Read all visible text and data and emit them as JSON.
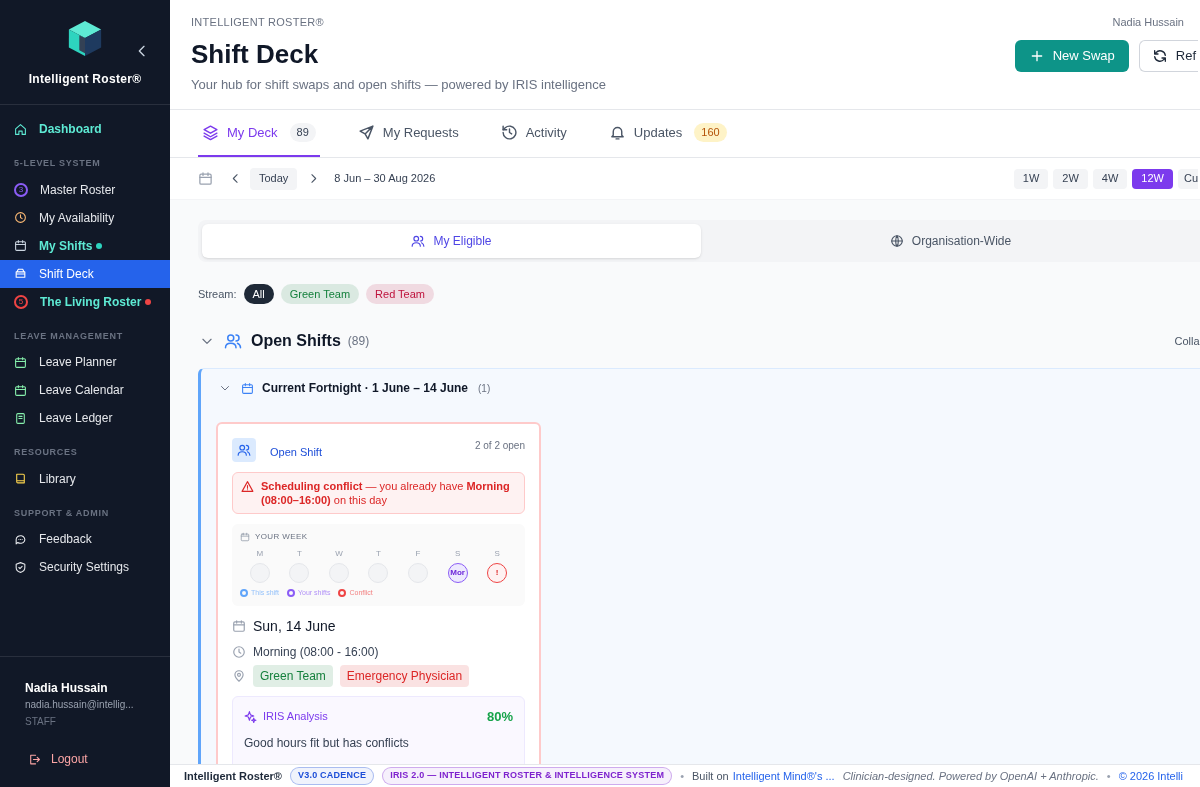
{
  "sidebar": {
    "brand": "Intelligent Roster®",
    "groups": [
      {
        "items": [
          {
            "label": "Dashboard",
            "kind": "home",
            "selected": false,
            "highlight": true
          }
        ]
      },
      {
        "heading": "5-LEVEL SYSTEM",
        "items": [
          {
            "label": "Master Roster",
            "kind": "number",
            "badge": "3",
            "color": "#8b5cf6",
            "selected": false,
            "highlight": false,
            "dot": false
          },
          {
            "label": "My Availability",
            "kind": "clock",
            "selected": false,
            "highlight": false
          },
          {
            "label": "My Shifts",
            "kind": "calendar",
            "selected": false,
            "highlight": true,
            "dot": true,
            "color": "#2dd4bf"
          },
          {
            "label": "Shift Deck",
            "kind": "deck",
            "selected": true,
            "highlight": false
          },
          {
            "label": "The Living Roster",
            "kind": "number",
            "badge": "5",
            "color": "#ef4444",
            "selected": false,
            "highlight": true,
            "dot": true
          }
        ]
      },
      {
        "heading": "LEAVE MANAGEMENT",
        "items": [
          {
            "label": "Leave Planner",
            "kind": "calendar",
            "selected": false,
            "highlight": false
          },
          {
            "label": "Leave Calendar",
            "kind": "calendar",
            "selected": false,
            "highlight": false
          },
          {
            "label": "Leave Ledger",
            "kind": "ledger",
            "selected": false,
            "highlight": false
          }
        ]
      },
      {
        "heading": "RESOURCES",
        "items": [
          {
            "label": "Library",
            "kind": "book",
            "selected": false,
            "highlight": false
          }
        ]
      },
      {
        "heading": "SUPPORT & ADMIN",
        "items": [
          {
            "label": "Feedback",
            "kind": "chat",
            "selected": false,
            "highlight": false
          },
          {
            "label": "Security Settings",
            "kind": "shield",
            "selected": false,
            "highlight": false
          }
        ]
      }
    ],
    "user": {
      "name": "Nadia Hussain",
      "email": "nadia.hussain@intellig...",
      "role": "STAFF"
    },
    "logout": "Logout"
  },
  "header": {
    "eyebrow": "INTELLIGENT ROSTER®",
    "title": "Shift Deck",
    "subtitle": "Your hub for shift swaps and open shifts — powered by IRIS intelligence",
    "user": "Nadia Hussain",
    "primary_button": "New Swap",
    "secondary_button": "Ref"
  },
  "tabs": [
    {
      "label": "My Deck",
      "kind": "layers",
      "count": "89",
      "selected": true
    },
    {
      "label": "My Requests",
      "kind": "send",
      "selected": false
    },
    {
      "label": "Activity",
      "kind": "history",
      "selected": false
    },
    {
      "label": "Updates",
      "kind": "bell",
      "count": "160",
      "selected": false
    }
  ],
  "toolbar": {
    "today": "Today",
    "range": "8 Jun – 30 Aug 2026",
    "ranges": [
      {
        "label": "1W",
        "selected": false
      },
      {
        "label": "2W",
        "selected": false
      },
      {
        "label": "4W",
        "selected": false
      },
      {
        "label": "12W",
        "selected": true
      },
      {
        "label": "Cu",
        "selected": false
      }
    ]
  },
  "scope": [
    {
      "label": "My Eligible",
      "kind": "users",
      "selected": true
    },
    {
      "label": "Organisation-Wide",
      "kind": "globe",
      "selected": false
    }
  ],
  "stream": {
    "label": "Stream:",
    "options": [
      {
        "label": "All",
        "selected": true,
        "color": "#1f2937"
      },
      {
        "label": "Green Team",
        "selected": false,
        "color": "#15803d"
      },
      {
        "label": "Red Team",
        "selected": false,
        "color": "#be123c"
      }
    ]
  },
  "section": {
    "title": "Open Shifts",
    "count": "(89)",
    "collapse": "Colla",
    "expanded": true,
    "group": {
      "title": "Current Fortnight · 1 June – 14 June",
      "count": "(1)",
      "expanded": true,
      "card": {
        "type": "Open Shift",
        "availability": "2 of 2 open",
        "conflict": "**Scheduling conflict** — you already have **Morning (08:00–16:00)** on this day",
        "week_title": "YOUR WEEK",
        "days": [
          {
            "letter": "M",
            "kind": "empty"
          },
          {
            "letter": "T",
            "kind": "empty"
          },
          {
            "letter": "W",
            "kind": "empty"
          },
          {
            "letter": "T",
            "kind": "empty"
          },
          {
            "letter": "F",
            "kind": "empty"
          },
          {
            "letter": "S",
            "kind": "yours",
            "mark": "Mor"
          },
          {
            "letter": "S",
            "kind": "conflict",
            "mark": "!"
          }
        ],
        "legend": [
          {
            "label": "This shift",
            "color": "#60a5fa"
          },
          {
            "label": "Your shifts",
            "color": "#8b5cf6"
          },
          {
            "label": "Conflict",
            "color": "#ef4444"
          }
        ],
        "date": "Sun, 14 June",
        "time": "Morning (08:00 - 16:00)",
        "tags": [
          {
            "label": "Green Team",
            "color": "#15803d"
          },
          {
            "label": "Emergency Physician",
            "color": "#dc2626"
          }
        ],
        "analysis": {
          "title": "IRIS Analysis",
          "score": "80%",
          "summary": "Good hours fit but has conflicts"
        }
      }
    }
  },
  "footer": {
    "brand": "Intelligent Roster®",
    "badges": [
      {
        "label": "V3.0 CADENCE",
        "color": "#1d4ed8"
      },
      {
        "label": "IRIS 2.0 — INTELLIGENT ROSTER & INTELLIGENCE SYSTEM",
        "color": "#7e22ce"
      }
    ],
    "separators": [
      "•",
      "•"
    ],
    "built_prefix": "Built on",
    "built_link": "Intelligent Mind®'s ...",
    "tagline": "Clinician-designed. Powered by OpenAI + Anthropic.",
    "copyright": "© 2026 Intelli"
  }
}
